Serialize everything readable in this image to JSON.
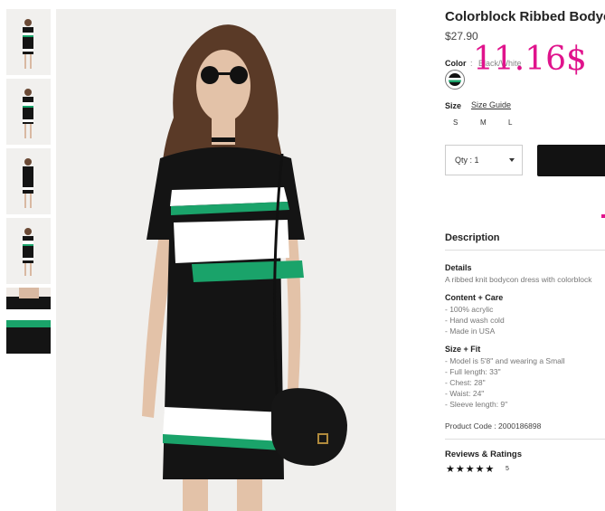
{
  "product": {
    "title": "Colorblock Ribbed Bodycon",
    "price": "$27.90",
    "overlay_price": "11.16$",
    "color_label": "Color",
    "color_sep": ":",
    "color_value": "Black/White",
    "size_label": "Size",
    "size_guide": "Size Guide",
    "sizes": [
      "S",
      "M",
      "L"
    ],
    "qty": "Qty : 1"
  },
  "description": {
    "heading": "Description",
    "details_heading": "Details",
    "details_text": "A ribbed knit bodycon dress with colorblock",
    "content_heading": "Content + Care",
    "content_items": [
      "- 100% acrylic",
      "- Hand wash cold",
      "- Made in USA"
    ],
    "fit_heading": "Size + Fit",
    "fit_items": [
      "- Model is 5'8\" and wearing a Small",
      "- Full length: 33\"",
      "- Chest: 28\"",
      "- Waist: 24\"",
      "- Sleeve length: 9\""
    ],
    "product_code": "Product Code : 2000186898"
  },
  "reviews": {
    "heading": "Reviews & Ratings",
    "stars": "★★★★★",
    "count": "5"
  },
  "colors": {
    "accent_price": "#e0138c",
    "dress_green": "#1aa36a",
    "dress_black": "#141414"
  }
}
